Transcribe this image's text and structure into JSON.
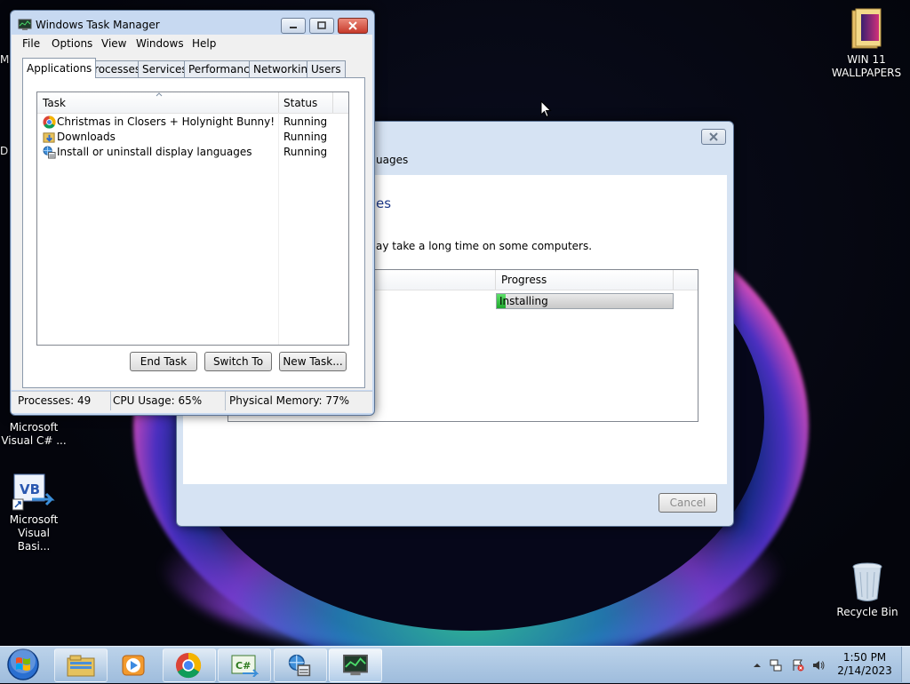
{
  "desktop": {
    "icons": [
      {
        "label": "WIN 11\nWALLPAPERS",
        "icon": "folder-icon"
      },
      {
        "label": "Microsoft\nVisual C# ...",
        "icon": "visual-csharp-icon"
      },
      {
        "label": "Microsoft\nVisual Basi...",
        "icon": "visual-basic-icon"
      },
      {
        "label": "Recycle Bin",
        "icon": "recycle-bin-icon"
      }
    ],
    "partial_left_1": "M",
    "partial_left_2": "D"
  },
  "task_manager": {
    "title": "Windows Task Manager",
    "menu": [
      "File",
      "Options",
      "View",
      "Windows",
      "Help"
    ],
    "tabs": [
      "Applications",
      "Processes",
      "Services",
      "Performance",
      "Networking",
      "Users"
    ],
    "active_tab": "Applications",
    "columns": [
      "Task",
      "Status"
    ],
    "rows": [
      {
        "task": "Christmas in Closers + Holynight Bunny! - CLOS...",
        "status": "Running",
        "icon": "chrome-icon"
      },
      {
        "task": "Downloads",
        "status": "Running",
        "icon": "folder-download-icon"
      },
      {
        "task": "Install or uninstall display languages",
        "status": "Running",
        "icon": "language-install-icon"
      }
    ],
    "buttons": {
      "end_task": "End Task",
      "switch_to": "Switch To",
      "new_task": "New Task..."
    },
    "status_bar": {
      "processes": "Processes: 49",
      "cpu": "CPU Usage: 65%",
      "memory": "Physical Memory: 77%"
    }
  },
  "installer": {
    "title_partial": "uages",
    "heading_partial": "es",
    "description_partial": "ay take a long time on some computers.",
    "progress_header": "Progress",
    "progress_status": "Installing",
    "progress_fraction": 0.05,
    "cancel_label": "Cancel"
  },
  "taskbar": {
    "clock_time": "1:50 PM",
    "clock_date": "2/14/2023"
  },
  "colors": {
    "accent_progress": "#2fbf3a",
    "close_button": "#d9453c"
  }
}
